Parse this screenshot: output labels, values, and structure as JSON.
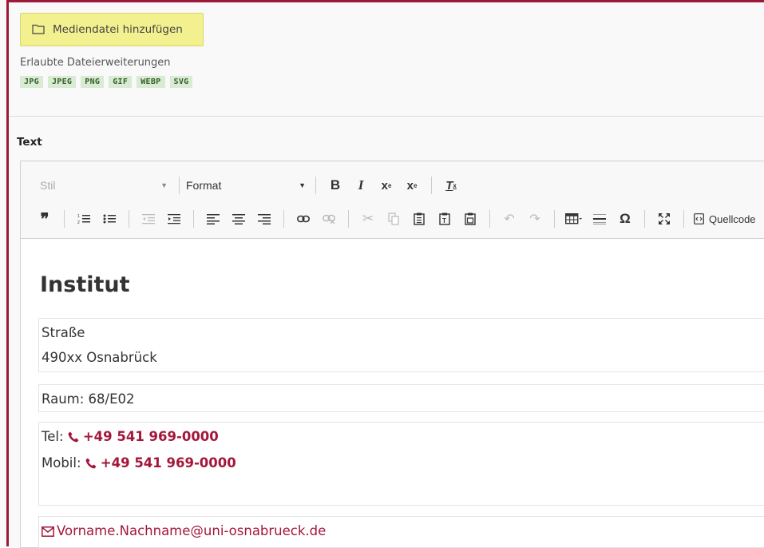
{
  "media": {
    "add_button_label": "Mediendatei hinzufügen",
    "allowed_extensions_label": "Erlaubte Dateierweiterungen",
    "extensions": [
      "JPG",
      "JPEG",
      "PNG",
      "GIF",
      "WEBP",
      "SVG"
    ]
  },
  "text_field": {
    "label": "Text"
  },
  "toolbar": {
    "style_combo": "Stil",
    "format_combo": "Format",
    "source_label": "Quellcode"
  },
  "content": {
    "heading": "Institut",
    "address_street": "Straße",
    "address_city": "490xx Osnabrück",
    "room": "Raum: 68/E02",
    "tel_label": "Tel:",
    "tel_number": "+49 541 969-0000",
    "mobile_label": "Mobil:",
    "mobile_number": "+49 541 969-0000",
    "email": "Vorname.Nachname@uni-osnabrueck.de"
  },
  "colors": {
    "accent": "#9b1a3a",
    "link": "#a3173a",
    "button_bg": "#f3f18f",
    "badge_bg": "#d9ebd3"
  }
}
